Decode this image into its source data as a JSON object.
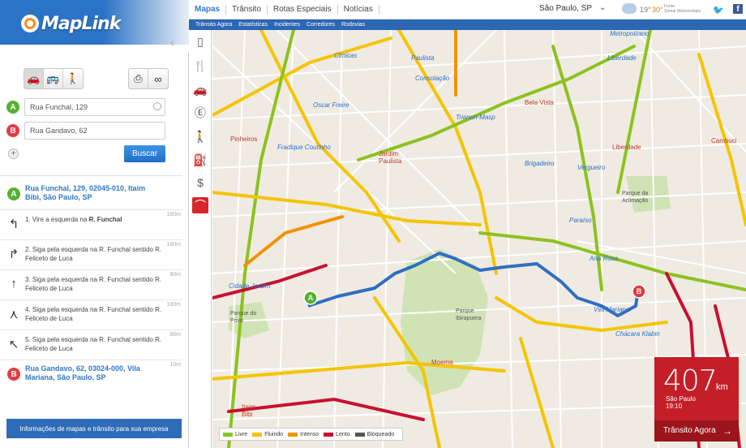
{
  "brand": {
    "logo_text": "MapLink"
  },
  "topnav": {
    "items": [
      "Mapas",
      "Trânsito",
      "Rotas Especiais",
      "Notícias"
    ],
    "city": "São Paulo, SP",
    "temp_low": "19°",
    "temp_high": "30°",
    "source_line1": "Fonte:",
    "source_line2": "Somar Meteorologia"
  },
  "subnav": {
    "items": [
      "Trânsito Agora",
      "Estatísticas",
      "Incidentes",
      "Corredores",
      "Rodovias"
    ]
  },
  "directions": {
    "origin_value": "Rua Funchal, 129",
    "destination_value": "Rua Gandavo, 62",
    "search_label": "Buscar",
    "add_label": "+",
    "start": {
      "label": "Rua Funchal, 129, 02045-010, Itaim Bibi, São Paulo, SP",
      "pin": "A"
    },
    "end": {
      "label": "Rua Gandavo, 62, 03024-000, Vila Mariana, São Paulo, SP",
      "pin": "B"
    },
    "end_dist": "10m",
    "steps": [
      {
        "text_pre": "1. Vire a  esquerda na ",
        "text_bold": "R. Funchal",
        "dist": "180m",
        "icon": "turn-left-icon"
      },
      {
        "text_pre": "2. Siga pela esquerda na R. Funchal sentido R. Feliceto de Luca",
        "text_bold": "",
        "dist": "180m",
        "icon": "keep-right-icon"
      },
      {
        "text_pre": "3. Siga pela esquerda na R. Funchal sentido R. Feliceto de Luca",
        "text_bold": "",
        "dist": "80m",
        "icon": "straight-icon"
      },
      {
        "text_pre": "4. Siga pela esquerda na R. Funchal sentido R. Feliceto de Luca",
        "text_bold": "",
        "dist": "180m",
        "icon": "fork-icon"
      },
      {
        "text_pre": "5. Siga pela esquerda na R. Funchal sentido R. Feliceto de Luca",
        "text_bold": "",
        "dist": "80m",
        "icon": "bear-left-icon"
      }
    ],
    "info_button": "Informações de mapas e trânsito para sua empresa"
  },
  "legend": [
    {
      "label": "Livre",
      "color": "#8dc21f"
    },
    {
      "label": "Fluindo",
      "color": "#f5c400"
    },
    {
      "label": "Intenso",
      "color": "#f39200"
    },
    {
      "label": "Lento",
      "color": "#c8102e"
    },
    {
      "label": "Bloqueado",
      "color": "#555555"
    }
  ],
  "traffic": {
    "km_value": "407",
    "unit": "km",
    "place": "São Paulo",
    "time": "19:10",
    "link_label": "Trânsito Agora"
  },
  "map_labels": {
    "clinicas": "Clínicas",
    "paulista": "Paulista",
    "consolacao": "Consolação",
    "liberdade": "Liberdade",
    "oscar_freire": "Oscar Freire",
    "trianon": "Trianon-Masp",
    "bela_vista": "Bela Vista",
    "pinheiros": "Pinheiros",
    "fradique": "Fradique Coutinho",
    "jardim_paulista": "Jardim Paulista",
    "brigadeiro": "Brigadeiro",
    "vergueiro": "Vergueiro",
    "liberdade2": "Liberdade",
    "cambuci": "Cambuci",
    "parque_aclimacao": "Parque da Aclimação",
    "paraiso": "Paraíso",
    "ana_rosa": "Ana Rosa",
    "cidade_jardim": "Cidade Jardim",
    "parque_povo": "Parque do Povo",
    "parque_ibirapuera": "Parque Ibirapuera",
    "moema": "Moema",
    "itaim_bibi": "Itaim Bibi",
    "chacara_klabin": "Chácara Klabin",
    "vila_mariana": "Vila Mariana",
    "metropolitano": "Metropolitano"
  }
}
